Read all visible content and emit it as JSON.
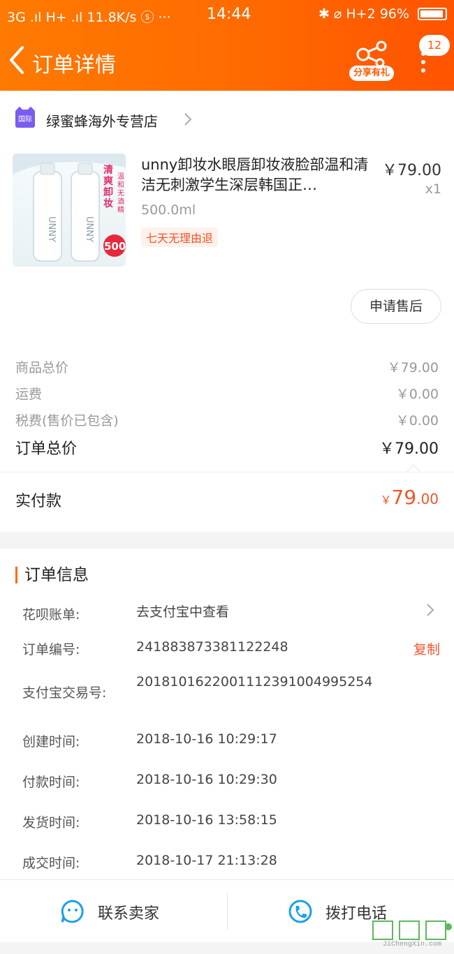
{
  "status_bar": {
    "network": "3G .ıl H+ .ıl 11.8K/s ⓢ ···",
    "time": "14:44",
    "indicators": "✱ ⌀ H+2",
    "battery": "96%"
  },
  "nav": {
    "title": "订单详情",
    "share_label": "分享有礼",
    "badge": "12"
  },
  "store": {
    "tag": "国际",
    "name": "绿蜜蜂海外专营店"
  },
  "product": {
    "title": "unny卸妆水眼唇卸妆液脸部温和清洁无刺激学生深层韩国正…",
    "spec": "500.0ml",
    "tag": "七天无理由退",
    "price": "￥79.00",
    "qty": "x1",
    "image_text_main": "清爽卸妆",
    "image_text_side": "温和无酒精",
    "image_text_badge": "500",
    "image_brand": "UNNY",
    "aftersale_label": "申请售后"
  },
  "summary": {
    "goods_label": "商品总价",
    "goods_value": "￥79.00",
    "shipping_label": "运费",
    "shipping_value": "￥0.00",
    "tax_label": "税费(售价已包含)",
    "tax_value": "￥0.00",
    "total_label": "订单总价",
    "total_value": "￥79.00",
    "paid_label": "实付款",
    "paid_currency": "￥",
    "paid_int": "79",
    "paid_dec": ".00"
  },
  "order_info": {
    "title": "订单信息",
    "rows": [
      {
        "label": "花呗账单:",
        "value": "去支付宝中查看"
      },
      {
        "label": "订单编号:",
        "value": "241883873381122248",
        "action": "复制"
      },
      {
        "label": "支付宝交易号:",
        "value": "2018101622001112391004995254"
      },
      {
        "label": "创建时间:",
        "value": "2018-10-16 10:29:17"
      },
      {
        "label": "付款时间:",
        "value": "2018-10-16 10:29:30"
      },
      {
        "label": "发货时间:",
        "value": "2018-10-16 13:58:15"
      },
      {
        "label": "成交时间:",
        "value": "2018-10-17 21:13:28"
      }
    ]
  },
  "bottom": {
    "contact_label": "联系卖家",
    "call_label": "拨打电话"
  },
  "watermark": {
    "text": "JiChengXin.com"
  },
  "colors": {
    "header_start": "#ff7a00",
    "header_end": "#ff5300",
    "accent": "#f0552a",
    "icon_blue": "#1aa0e8"
  }
}
